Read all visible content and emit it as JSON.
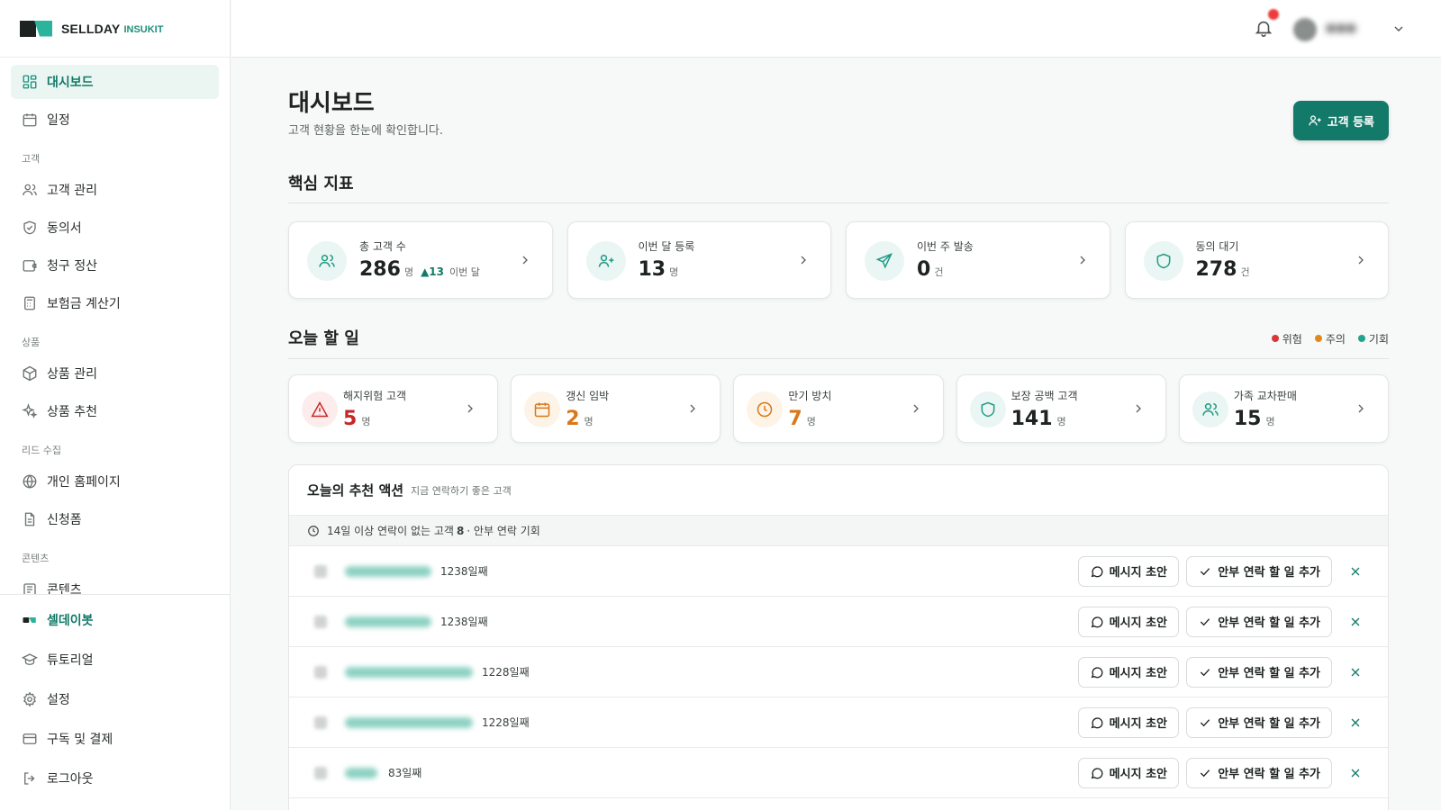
{
  "brand": {
    "name": "SELLDAY",
    "sub": "INSUKIT"
  },
  "sidebar": {
    "items": [
      {
        "label": "대시보드",
        "icon": "grid-icon",
        "active": true
      },
      {
        "label": "일정",
        "icon": "calendar-icon"
      }
    ],
    "sections": [
      {
        "title": "고객",
        "items": [
          {
            "label": "고객 관리",
            "icon": "users-icon"
          },
          {
            "label": "동의서",
            "icon": "shield-check-icon"
          },
          {
            "label": "청구 정산",
            "icon": "wallet-icon"
          },
          {
            "label": "보험금 계산기",
            "icon": "calculator-icon"
          }
        ]
      },
      {
        "title": "상품",
        "items": [
          {
            "label": "상품 관리",
            "icon": "box-icon"
          },
          {
            "label": "상품 추천",
            "icon": "sparkle-icon"
          }
        ]
      },
      {
        "title": "리드 수집",
        "items": [
          {
            "label": "개인 홈페이지",
            "icon": "globe-icon"
          },
          {
            "label": "신청폼",
            "icon": "document-icon"
          }
        ]
      },
      {
        "title": "콘텐츠",
        "items": [
          {
            "label": "콘텐츠",
            "icon": "newspaper-icon"
          }
        ]
      }
    ],
    "bottom": [
      {
        "label": "셀데이봇",
        "icon": "bot-icon"
      },
      {
        "label": "튜토리얼",
        "icon": "graduation-cap-icon"
      },
      {
        "label": "설정",
        "icon": "gear-icon"
      },
      {
        "label": "구독 및 결제",
        "icon": "credit-card-icon"
      },
      {
        "label": "로그아웃",
        "icon": "logout-icon"
      }
    ]
  },
  "header": {
    "title": "대시보드",
    "subtitle": "고객 현황을 한눈에 확인합니다.",
    "add_button": "고객 등록"
  },
  "kpi_section": {
    "title": "핵심 지표",
    "cards": [
      {
        "label": "총 고객 수",
        "value": "286",
        "unit": "명",
        "delta": "▲13",
        "delta_label": "이번 달",
        "icon": "users-icon"
      },
      {
        "label": "이번 달 등록",
        "value": "13",
        "unit": "명",
        "icon": "user-plus-icon"
      },
      {
        "label": "이번 주 발송",
        "value": "0",
        "unit": "건",
        "icon": "send-icon"
      },
      {
        "label": "동의 대기",
        "value": "278",
        "unit": "건",
        "icon": "shield-icon"
      }
    ]
  },
  "todo_section": {
    "title": "오늘 할 일",
    "legend": [
      {
        "label": "위험",
        "color": "#d93636"
      },
      {
        "label": "주의",
        "color": "#e08a1e"
      },
      {
        "label": "기회",
        "color": "#1fa58c"
      }
    ],
    "cards": [
      {
        "label": "해지위험 고객",
        "value": "5",
        "unit": "명",
        "color": "#c62828",
        "bg": "#fdecec",
        "icon": "alert-triangle-icon"
      },
      {
        "label": "갱신 임박",
        "value": "2",
        "unit": "명",
        "color": "#d9771a",
        "bg": "#fdf3e6",
        "icon": "calendar-icon"
      },
      {
        "label": "만기 방치",
        "value": "7",
        "unit": "명",
        "color": "#d9771a",
        "bg": "#fdf3e6",
        "icon": "clock-icon"
      },
      {
        "label": "보장 공백 고객",
        "value": "141",
        "unit": "명",
        "color": "#1d2321",
        "bg": "#eaf6f3",
        "icon": "shield-icon"
      },
      {
        "label": "가족 교차판매",
        "value": "15",
        "unit": "명",
        "color": "#1d2321",
        "bg": "#eaf6f3",
        "icon": "users-icon"
      }
    ]
  },
  "recommend": {
    "title": "오늘의 추천 액션",
    "subtitle": "지금 연락하기 좋은 고객",
    "group": {
      "pre": "14일 이상 연락이 없는 고객",
      "count": "8",
      "post": "· 안부 연락 기회"
    },
    "draft_label": "메시지 초안",
    "add_label": "안부 연락 할 일 추가",
    "rows": [
      {
        "days": "1238일째"
      },
      {
        "days": "1238일째"
      },
      {
        "days": "1228일째"
      },
      {
        "days": "1228일째"
      },
      {
        "days": "83일째"
      }
    ]
  }
}
